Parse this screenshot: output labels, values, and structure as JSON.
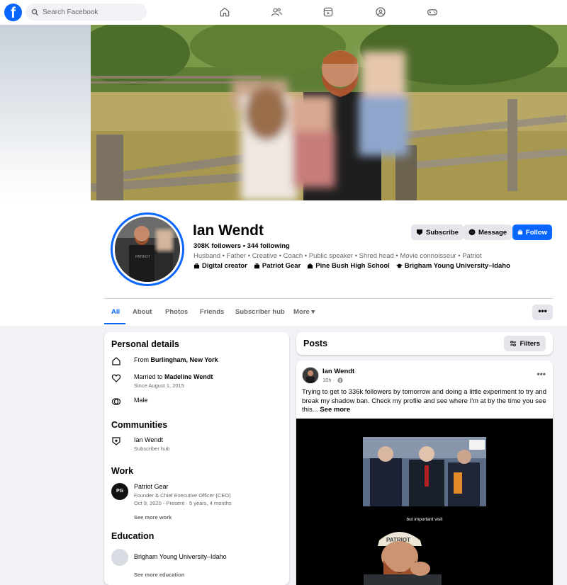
{
  "nav": {
    "logo": "f",
    "search_placeholder": "Search Facebook",
    "icons": [
      "home-icon",
      "friends-icon",
      "video-icon",
      "groups-icon",
      "gaming-icon"
    ]
  },
  "profile": {
    "name": "Ian Wendt",
    "followers": "308K followers",
    "following": "344 following",
    "bio": "Husband • Father • Creative • Coach • Public speaker • Shred head • Movie connoisseur • Patriot",
    "facts": [
      {
        "icon": "briefcase-icon",
        "label": "Digital creator"
      },
      {
        "icon": "briefcase-icon",
        "label": "Patriot Gear"
      },
      {
        "icon": "school-icon",
        "label": "Pine Bush High School"
      },
      {
        "icon": "graduation-cap-icon",
        "label": "Brigham Young University–Idaho"
      }
    ],
    "buttons": {
      "subscribe": "Subscribe",
      "message": "Message",
      "follow": "Follow"
    }
  },
  "tabs": {
    "items": [
      "All",
      "About",
      "Photos",
      "Friends",
      "Subscriber hub",
      "More"
    ],
    "active": "All",
    "more_menu": "•••"
  },
  "intro": {
    "personal_title": "Personal details",
    "from_prefix": "From ",
    "from": "Burlingham, New York",
    "married_prefix": "Married to ",
    "married_to": "Madeline Wendt",
    "married_since": "Since August 1, 2015",
    "gender": "Male",
    "communities_title": "Communities",
    "community_name": "Ian Wendt",
    "community_sub": "Subscriber hub",
    "work_title": "Work",
    "work_company": "Patriot Gear",
    "work_role": "Founder & Chief Executive Officer (CEO)",
    "work_dates": "Oct 9, 2020 - Present · 5 years, 4 months",
    "work_more": "See more work",
    "education_title": "Education",
    "school": "Brigham Young University–Idaho",
    "education_more": "See more education"
  },
  "posts": {
    "title": "Posts",
    "filters": "Filters",
    "post": {
      "author": "Ian Wendt",
      "time": "10h",
      "menu": "•••",
      "text": "Trying to get to 336k followers by tomorrow and doing a little experiment to try and break my shadow ban. Check my profile and see where I'm at by the time you see this...",
      "see_more": "See more",
      "video_caption": "but important visit"
    }
  },
  "colors": {
    "brand": "#0866ff",
    "page_bg": "#f0f2f5",
    "muted": "#65676b"
  }
}
